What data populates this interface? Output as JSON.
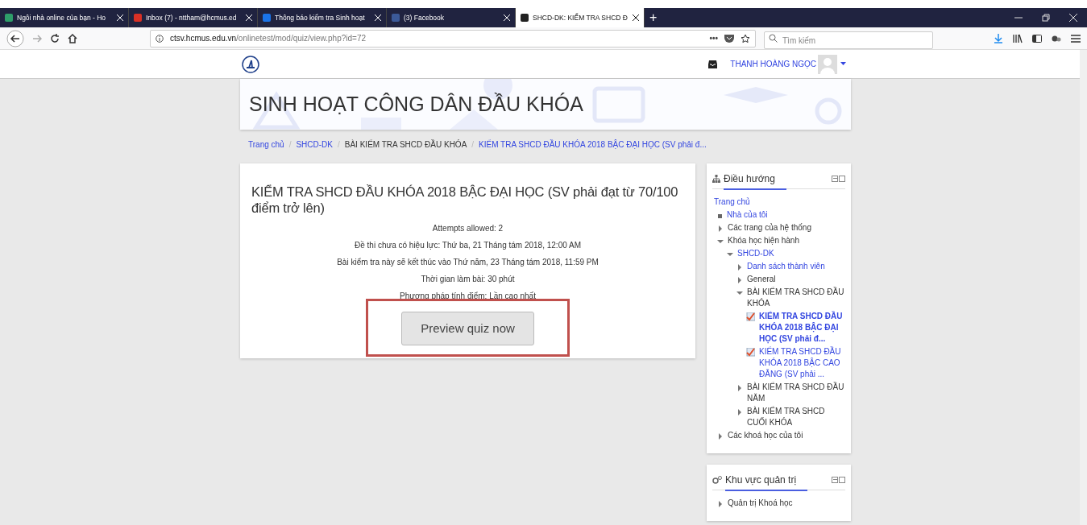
{
  "browser": {
    "tabs": [
      {
        "label": "Ngôi nhà online của bạn - Ho",
        "color": "#2e9e6a",
        "selected": false
      },
      {
        "label": "Inbox (7) - nttham@hcmus.ed",
        "color": "#d93025",
        "selected": false
      },
      {
        "label": "Thông báo kiểm tra Sinh hoạt",
        "color": "#1a73e8",
        "selected": false
      },
      {
        "label": "(3) Facebook",
        "color": "#3b5998",
        "selected": false
      },
      {
        "label": "SHCD-DK: KIỂM TRA SHCD Đ",
        "color": "#222222",
        "selected": true
      }
    ],
    "new_tab": "+",
    "url_host": "ctsv.hcmus.edu.vn",
    "url_path": "/onlinetest/mod/quiz/view.php?id=72",
    "page_actions": "•••",
    "search": {
      "placeholder": "Tìm kiếm"
    }
  },
  "navbar": {
    "user": "THANH HOÀNG NGỌC"
  },
  "header": {
    "title": "SINH HOẠT CÔNG DÂN ĐẦU KHÓA"
  },
  "breadcrumb_separator": "/",
  "breadcrumb": [
    {
      "label": "Trang chủ",
      "link": true
    },
    {
      "label": "SHCD-DK",
      "link": true
    },
    {
      "label": "BÀI KIỂM TRA SHCD ĐẦU KHÓA",
      "link": false
    },
    {
      "label": "KIỂM TRA SHCD ĐẦU KHÓA 2018 BẬC ĐẠI HỌC (SV phải đ...",
      "link": true
    }
  ],
  "quiz": {
    "title": "KIỂM TRA SHCD ĐẦU KHÓA 2018 BẬC ĐẠI HỌC (SV phải đạt từ 70/100 điểm trở lên)",
    "info": [
      "Attempts allowed: 2",
      "Đề thi chưa có hiệu lực: Thứ ba, 21 Tháng tám 2018, 12:00 AM",
      "Bài kiểm tra này sẽ kết thúc vào Thứ năm, 23 Tháng tám 2018, 11:59 PM",
      "Thời gian làm bài: 30 phút",
      "Phương pháp tính điểm: Lần cao nhất"
    ],
    "button": "Preview quiz now",
    "highlighted": true
  },
  "navigation": {
    "title": "Điều hướng",
    "tree": [
      {
        "label": "Trang chủ",
        "kind": "root",
        "link": true,
        "children": [
          {
            "label": "Nhà của tôi",
            "kind": "leaf",
            "link": true
          },
          {
            "label": "Các trang của hệ thống",
            "kind": "branch",
            "expanded": false,
            "link": false
          },
          {
            "label": "Khóa học hiện hành",
            "kind": "branch",
            "expanded": true,
            "link": false,
            "children": [
              {
                "label": "SHCD-DK",
                "kind": "branch",
                "expanded": true,
                "link": true,
                "children": [
                  {
                    "label": "Danh sách thành viên",
                    "kind": "branch",
                    "expanded": false,
                    "link": true
                  },
                  {
                    "label": "General",
                    "kind": "branch",
                    "expanded": false,
                    "link": false
                  },
                  {
                    "label": "BÀI KIỂM TRA SHCD ĐẦU KHÓA",
                    "kind": "branch",
                    "expanded": true,
                    "link": false,
                    "children": [
                      {
                        "label": "KIỂM TRA SHCD ĐẦU KHÓA 2018 BẬC ĐẠI HỌC (SV phải đ...",
                        "kind": "quiz",
                        "active": true,
                        "link": true
                      },
                      {
                        "label": "KIỂM TRA SHCD ĐẦU KHÓA 2018 BẬC CAO ĐẲNG (SV phải ...",
                        "kind": "quiz",
                        "active": false,
                        "link": true
                      }
                    ]
                  },
                  {
                    "label": "BÀI KIỂM TRA SHCD ĐẦU NĂM",
                    "kind": "branch",
                    "expanded": false,
                    "link": false
                  },
                  {
                    "label": "BÀI KIỂM TRA SHCD CUỐI KHÓA",
                    "kind": "branch",
                    "expanded": false,
                    "link": false
                  }
                ]
              }
            ]
          },
          {
            "label": "Các khoá học của tôi",
            "kind": "branch",
            "expanded": false,
            "link": false
          }
        ]
      }
    ]
  },
  "admin": {
    "title": "Khu vực quản trị",
    "items": [
      {
        "label": "Quản trị Khoá học",
        "kind": "branch",
        "expanded": false,
        "link": false
      }
    ]
  }
}
